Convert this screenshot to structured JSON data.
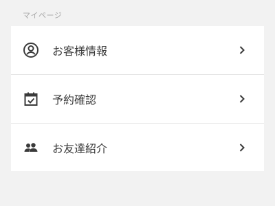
{
  "section": {
    "title": "マイページ"
  },
  "menu": {
    "items": [
      {
        "label": "お客様情報",
        "icon": "account-circle-icon"
      },
      {
        "label": "予約確認",
        "icon": "calendar-check-icon"
      },
      {
        "label": "お友達紹介",
        "icon": "people-icon"
      }
    ]
  },
  "colors": {
    "background": "#f2f2f2",
    "card": "#ffffff",
    "text": "#3a3a3a",
    "muted": "#a9a9a9",
    "divider": "#e6e6e6"
  }
}
